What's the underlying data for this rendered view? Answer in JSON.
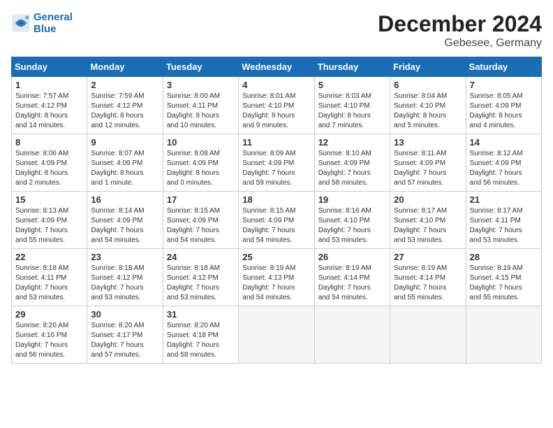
{
  "header": {
    "logo_line1": "General",
    "logo_line2": "Blue",
    "month": "December 2024",
    "location": "Gebesee, Germany"
  },
  "weekdays": [
    "Sunday",
    "Monday",
    "Tuesday",
    "Wednesday",
    "Thursday",
    "Friday",
    "Saturday"
  ],
  "weeks": [
    [
      {
        "day": "1",
        "info": "Sunrise: 7:57 AM\nSunset: 4:12 PM\nDaylight: 8 hours\nand 14 minutes."
      },
      {
        "day": "2",
        "info": "Sunrise: 7:59 AM\nSunset: 4:12 PM\nDaylight: 8 hours\nand 12 minutes."
      },
      {
        "day": "3",
        "info": "Sunrise: 8:00 AM\nSunset: 4:11 PM\nDaylight: 8 hours\nand 10 minutes."
      },
      {
        "day": "4",
        "info": "Sunrise: 8:01 AM\nSunset: 4:10 PM\nDaylight: 8 hours\nand 9 minutes."
      },
      {
        "day": "5",
        "info": "Sunrise: 8:03 AM\nSunset: 4:10 PM\nDaylight: 8 hours\nand 7 minutes."
      },
      {
        "day": "6",
        "info": "Sunrise: 8:04 AM\nSunset: 4:10 PM\nDaylight: 8 hours\nand 5 minutes."
      },
      {
        "day": "7",
        "info": "Sunrise: 8:05 AM\nSunset: 4:09 PM\nDaylight: 8 hours\nand 4 minutes."
      }
    ],
    [
      {
        "day": "8",
        "info": "Sunrise: 8:06 AM\nSunset: 4:09 PM\nDaylight: 8 hours\nand 2 minutes."
      },
      {
        "day": "9",
        "info": "Sunrise: 8:07 AM\nSunset: 4:09 PM\nDaylight: 8 hours\nand 1 minute."
      },
      {
        "day": "10",
        "info": "Sunrise: 8:08 AM\nSunset: 4:09 PM\nDaylight: 8 hours\nand 0 minutes."
      },
      {
        "day": "11",
        "info": "Sunrise: 8:09 AM\nSunset: 4:09 PM\nDaylight: 7 hours\nand 59 minutes."
      },
      {
        "day": "12",
        "info": "Sunrise: 8:10 AM\nSunset: 4:09 PM\nDaylight: 7 hours\nand 58 minutes."
      },
      {
        "day": "13",
        "info": "Sunrise: 8:11 AM\nSunset: 4:09 PM\nDaylight: 7 hours\nand 57 minutes."
      },
      {
        "day": "14",
        "info": "Sunrise: 8:12 AM\nSunset: 4:09 PM\nDaylight: 7 hours\nand 56 minutes."
      }
    ],
    [
      {
        "day": "15",
        "info": "Sunrise: 8:13 AM\nSunset: 4:09 PM\nDaylight: 7 hours\nand 55 minutes."
      },
      {
        "day": "16",
        "info": "Sunrise: 8:14 AM\nSunset: 4:09 PM\nDaylight: 7 hours\nand 54 minutes."
      },
      {
        "day": "17",
        "info": "Sunrise: 8:15 AM\nSunset: 4:09 PM\nDaylight: 7 hours\nand 54 minutes."
      },
      {
        "day": "18",
        "info": "Sunrise: 8:15 AM\nSunset: 4:09 PM\nDaylight: 7 hours\nand 54 minutes."
      },
      {
        "day": "19",
        "info": "Sunrise: 8:16 AM\nSunset: 4:10 PM\nDaylight: 7 hours\nand 53 minutes."
      },
      {
        "day": "20",
        "info": "Sunrise: 8:17 AM\nSunset: 4:10 PM\nDaylight: 7 hours\nand 53 minutes."
      },
      {
        "day": "21",
        "info": "Sunrise: 8:17 AM\nSunset: 4:11 PM\nDaylight: 7 hours\nand 53 minutes."
      }
    ],
    [
      {
        "day": "22",
        "info": "Sunrise: 8:18 AM\nSunset: 4:11 PM\nDaylight: 7 hours\nand 53 minutes."
      },
      {
        "day": "23",
        "info": "Sunrise: 8:18 AM\nSunset: 4:12 PM\nDaylight: 7 hours\nand 53 minutes."
      },
      {
        "day": "24",
        "info": "Sunrise: 8:18 AM\nSunset: 4:12 PM\nDaylight: 7 hours\nand 53 minutes."
      },
      {
        "day": "25",
        "info": "Sunrise: 8:19 AM\nSunset: 4:13 PM\nDaylight: 7 hours\nand 54 minutes."
      },
      {
        "day": "26",
        "info": "Sunrise: 8:19 AM\nSunset: 4:14 PM\nDaylight: 7 hours\nand 54 minutes."
      },
      {
        "day": "27",
        "info": "Sunrise: 8:19 AM\nSunset: 4:14 PM\nDaylight: 7 hours\nand 55 minutes."
      },
      {
        "day": "28",
        "info": "Sunrise: 8:19 AM\nSunset: 4:15 PM\nDaylight: 7 hours\nand 55 minutes."
      }
    ],
    [
      {
        "day": "29",
        "info": "Sunrise: 8:20 AM\nSunset: 4:16 PM\nDaylight: 7 hours\nand 56 minutes."
      },
      {
        "day": "30",
        "info": "Sunrise: 8:20 AM\nSunset: 4:17 PM\nDaylight: 7 hours\nand 57 minutes."
      },
      {
        "day": "31",
        "info": "Sunrise: 8:20 AM\nSunset: 4:18 PM\nDaylight: 7 hours\nand 58 minutes."
      },
      {
        "day": "",
        "info": ""
      },
      {
        "day": "",
        "info": ""
      },
      {
        "day": "",
        "info": ""
      },
      {
        "day": "",
        "info": ""
      }
    ]
  ]
}
